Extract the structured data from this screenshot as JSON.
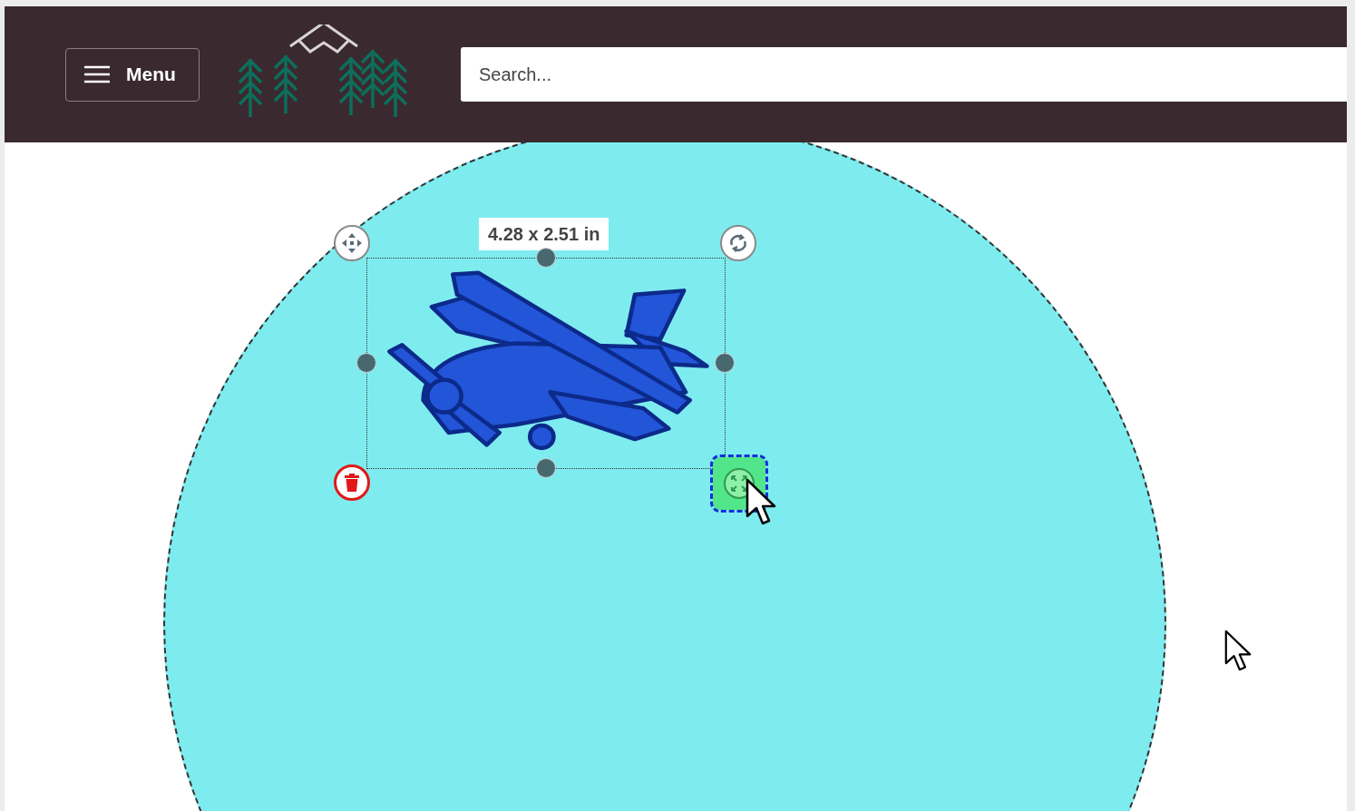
{
  "header": {
    "menu_label": "Menu",
    "search": {
      "placeholder": "Search..."
    }
  },
  "canvas": {
    "selection": {
      "dimensions": "4.28 x 2.51 in",
      "scale_handle_focused": true
    }
  }
}
